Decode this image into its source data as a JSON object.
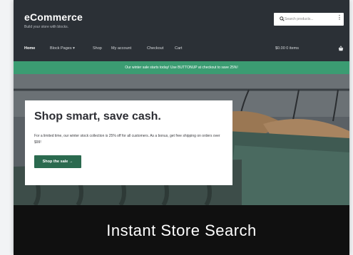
{
  "site": {
    "title": "eCommerce",
    "tagline": "Build your store with blocks."
  },
  "search": {
    "placeholder": "Search products...",
    "menu_glyph": "⋮"
  },
  "nav": {
    "items": [
      {
        "label": "Home",
        "active": true
      },
      {
        "label": "Block Pages  ▾",
        "active": false
      },
      {
        "label": "Shop",
        "active": false
      },
      {
        "label": "My account",
        "active": false
      },
      {
        "label": "Checkout",
        "active": false
      },
      {
        "label": "Cart",
        "active": false
      }
    ],
    "cart_total": "$0.00  0 items"
  },
  "banner": {
    "text": "Our winter sale starts today! Use BUTTONUP at checkout to save 25%!"
  },
  "hero": {
    "heading": "Shop smart, save cash.",
    "body": "For a limited time, our winter stock collection is 25% off for all customers. As a bonus, get free shipping on orders over $99!",
    "cta_label": "Shop the sale →"
  },
  "caption": {
    "text": "Instant Store Search"
  },
  "colors": {
    "header_bg": "#2b3036",
    "banner_bg": "#3b9c72",
    "cta_bg": "#2b6a4f",
    "caption_bg": "#101010"
  },
  "icons": {
    "search": "search-icon",
    "cart": "basket-icon",
    "more": "more-vertical-icon"
  }
}
